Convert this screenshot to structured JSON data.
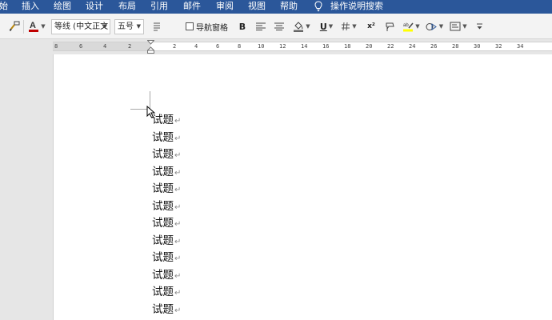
{
  "menu": {
    "items": [
      "始",
      "插入",
      "绘图",
      "设计",
      "布局",
      "引用",
      "邮件",
      "审阅",
      "视图",
      "帮助"
    ],
    "tell_me": "操作说明搜索"
  },
  "toolbar": {
    "font_name": "等线 (中文正文",
    "font_size": "五号",
    "nav_pane_label": "导航窗格",
    "bold_label": "B",
    "underline_label": "U",
    "superscript_label": "x²",
    "font_color": "#c00000",
    "highlight_color": "#ffff00"
  },
  "ruler": {
    "ticks": [
      "8",
      "6",
      "4",
      "2",
      "",
      "2",
      "4",
      "6",
      "8",
      "10",
      "12",
      "14",
      "16",
      "18",
      "20",
      "22",
      "24",
      "26",
      "28",
      "30",
      "32",
      "34"
    ]
  },
  "document": {
    "paragraph_mark": "↵",
    "paragraphs": [
      "试题",
      "试题",
      "试题",
      "试题",
      "试题",
      "试题",
      "试题",
      "试题",
      "试题",
      "试题",
      "试题",
      "试题"
    ]
  }
}
